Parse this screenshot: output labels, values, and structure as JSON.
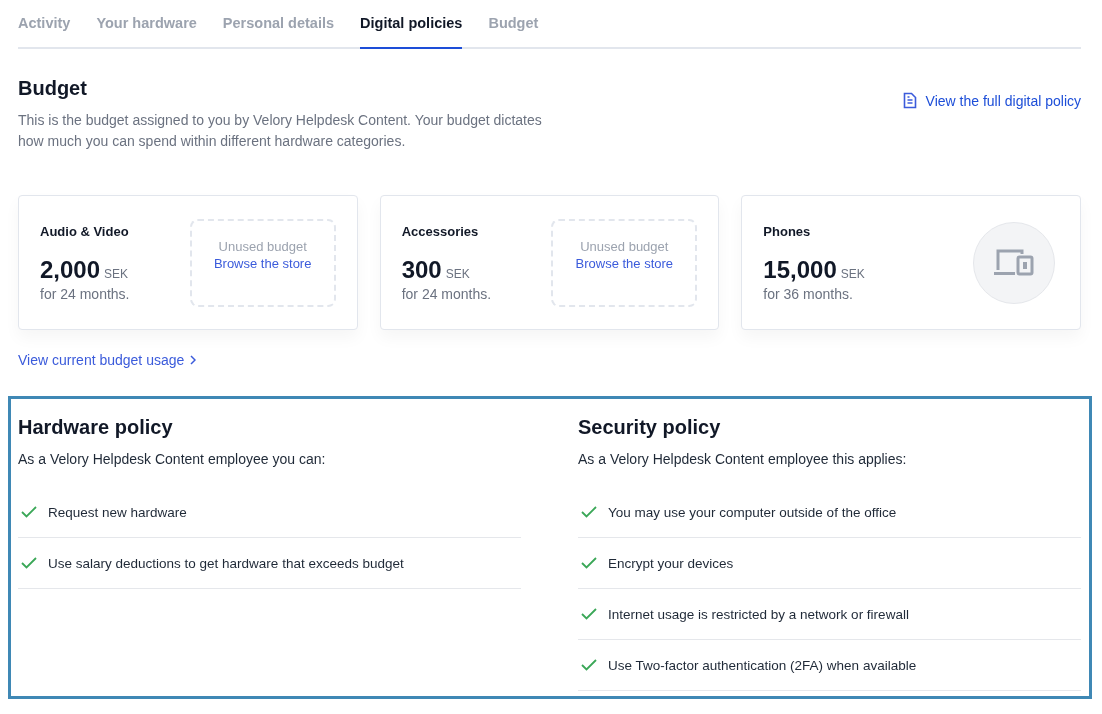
{
  "tabs": [
    {
      "label": "Activity",
      "selected": false
    },
    {
      "label": "Your hardware",
      "selected": false
    },
    {
      "label": "Personal details",
      "selected": false
    },
    {
      "label": "Digital policies",
      "selected": true
    },
    {
      "label": "Budget",
      "selected": false
    }
  ],
  "budget": {
    "title": "Budget",
    "description": "This is the budget assigned to you by Velory Helpdesk Content. Your budget dictates how much you can spend within different hardware categories.",
    "policy_link": "View the full digital policy",
    "cards": [
      {
        "kind": "unused",
        "category": "Audio & Video",
        "amount": "2,000",
        "currency": "SEK",
        "period": "for 24 months.",
        "unused_label": "Unused budget",
        "store_link": "Browse the store"
      },
      {
        "kind": "unused",
        "category": "Accessories",
        "amount": "300",
        "currency": "SEK",
        "period": "for 24 months.",
        "unused_label": "Unused budget",
        "store_link": "Browse the store"
      },
      {
        "kind": "icon",
        "category": "Phones",
        "amount": "15,000",
        "currency": "SEK",
        "period": "for 36 months."
      }
    ],
    "usage_link": "View current budget usage"
  },
  "policies": [
    {
      "title": "Hardware policy",
      "intro": "As a Velory Helpdesk Content employee you can:",
      "items": [
        {
          "text": "Request new hardware",
          "checked": true
        },
        {
          "text": "Use salary deductions to get hardware that exceeds budget",
          "checked": true
        }
      ]
    },
    {
      "title": "Security policy",
      "intro": "As a Velory Helpdesk Content employee this applies:",
      "items": [
        {
          "text": "You may use your computer outside of the office",
          "checked": true
        },
        {
          "text": "Encrypt your devices",
          "checked": true
        },
        {
          "text": "Internet usage is restricted by a network or firewall",
          "checked": true
        },
        {
          "text": "Use Two-factor authentication (2FA) when available",
          "checked": true
        }
      ]
    }
  ]
}
